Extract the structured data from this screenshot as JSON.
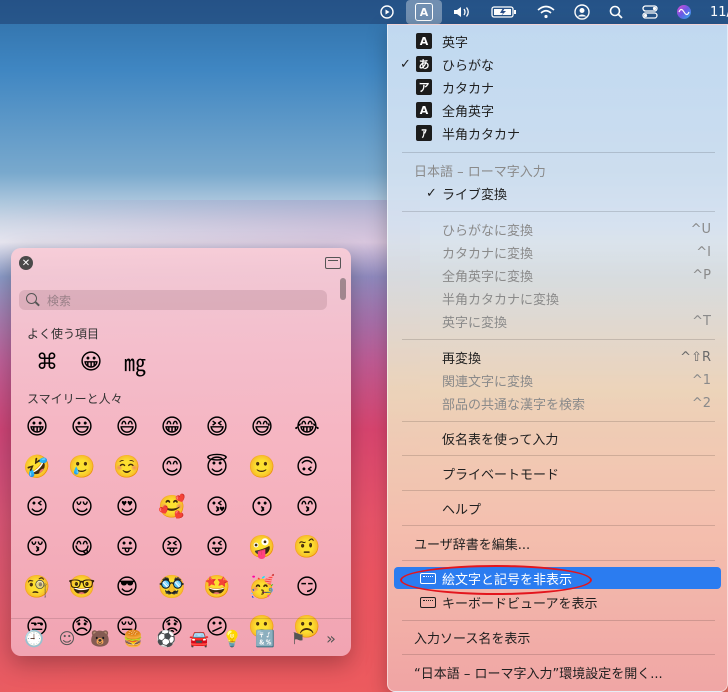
{
  "menubar": {
    "input_indicator": "A",
    "clock": "11/"
  },
  "menu": {
    "input_modes": [
      {
        "icon": "A",
        "label": "英字",
        "checked": false
      },
      {
        "icon": "あ",
        "label": "ひらがな",
        "checked": true
      },
      {
        "icon": "ア",
        "label": "カタカナ",
        "checked": false
      },
      {
        "icon": "A",
        "label": "全角英字",
        "checked": false
      },
      {
        "icon": "ｱ",
        "label": "半角カタカナ",
        "checked": false
      }
    ],
    "section_header": "日本語 – ローマ字入力",
    "live_conversion": "ライブ変換",
    "conversions": [
      {
        "label": "ひらがなに変換",
        "shortcut": "^U"
      },
      {
        "label": "カタカナに変換",
        "shortcut": "^I"
      },
      {
        "label": "全角英字に変換",
        "shortcut": "^P"
      },
      {
        "label": "半角カタカナに変換",
        "shortcut": ""
      },
      {
        "label": "英字に変換",
        "shortcut": "^T"
      }
    ],
    "reconvert": {
      "label": "再変換",
      "shortcut": "^⇧R"
    },
    "related": {
      "label": "関連文字に変換",
      "shortcut": "^1"
    },
    "search_kanji": {
      "label": "部品の共通な漢字を検索",
      "shortcut": "^2"
    },
    "kana_table": "仮名表を使って入力",
    "private_mode": "プライベートモード",
    "help": "ヘルプ",
    "edit_dictionary": "ユーザ辞書を編集...",
    "hide_emoji": "絵文字と記号を非表示",
    "keyboard_viewer": "キーボードビューアを表示",
    "show_source_name": "入力ソース名を表示",
    "open_prefs": "“日本語 – ローマ字入力”環境設定を開く..."
  },
  "emoji_panel": {
    "search_placeholder": "検索",
    "frequent_title": "よく使う項目",
    "frequent": [
      "⌘",
      "😀",
      "㎎"
    ],
    "smileys_title": "スマイリーと人々",
    "smileys": [
      "😀",
      "😃",
      "😄",
      "😁",
      "😆",
      "😅",
      "😂",
      "🤣",
      "🥲",
      "☺️",
      "😊",
      "😇",
      "🙂",
      "🙃",
      "😉",
      "😌",
      "😍",
      "🥰",
      "😘",
      "😗",
      "😙",
      "😚",
      "😋",
      "😛",
      "😝",
      "😜",
      "🤪",
      "🤨",
      "🧐",
      "🤓",
      "😎",
      "🥸",
      "🤩",
      "🥳",
      "😏",
      "😒",
      "😞",
      "😔",
      "😟",
      "😕",
      "🙁",
      "☹️"
    ],
    "tabs": [
      "🕘",
      "☺",
      "🐻",
      "🍔",
      "⚽",
      "🚘",
      "💡",
      "🔣",
      "⚑",
      "»"
    ]
  }
}
